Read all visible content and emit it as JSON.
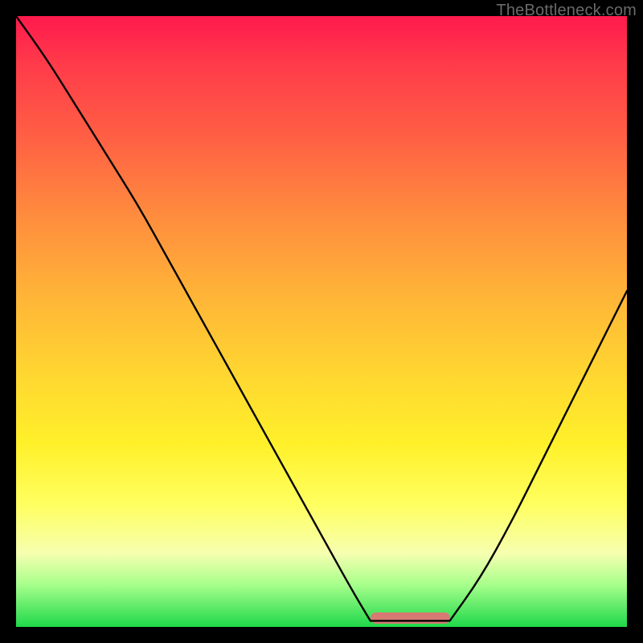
{
  "watermark": "TheBottleneck.com",
  "colors": {
    "gradient_top": "#ff1a4d",
    "gradient_mid1": "#ff8a3e",
    "gradient_mid2": "#ffd531",
    "gradient_mid3": "#fff02a",
    "gradient_bottom": "#1fd84a",
    "curve": "#000000",
    "bump": "#d87a74",
    "frame": "#000000"
  },
  "chart_data": {
    "type": "line",
    "title": "",
    "xlabel": "",
    "ylabel": "",
    "xlim": [
      0,
      100
    ],
    "ylim": [
      0,
      100
    ],
    "grid": false,
    "legend": false,
    "notes": "Axes are unlabeled; values estimated from pixel geometry. y is normalized height above plot bottom (0=bottom, 100=top). Two descending/ascending arms meeting in a flat valley ~x=58–71.",
    "series": [
      {
        "name": "left-arm",
        "x": [
          0,
          5,
          10,
          15,
          20,
          25,
          30,
          35,
          40,
          45,
          50,
          55,
          58
        ],
        "values": [
          100,
          93,
          85,
          77,
          69,
          60,
          51,
          42,
          33,
          24,
          15,
          6,
          1
        ]
      },
      {
        "name": "valley",
        "x": [
          58,
          62,
          66,
          71
        ],
        "values": [
          1,
          1,
          1,
          1
        ]
      },
      {
        "name": "right-arm",
        "x": [
          71,
          76,
          81,
          86,
          91,
          96,
          100
        ],
        "values": [
          1,
          8,
          17,
          27,
          37,
          47,
          55
        ]
      }
    ],
    "marker": {
      "name": "bump",
      "x_range": [
        58,
        71
      ],
      "y": 1.5,
      "color": "#d87a74"
    }
  }
}
